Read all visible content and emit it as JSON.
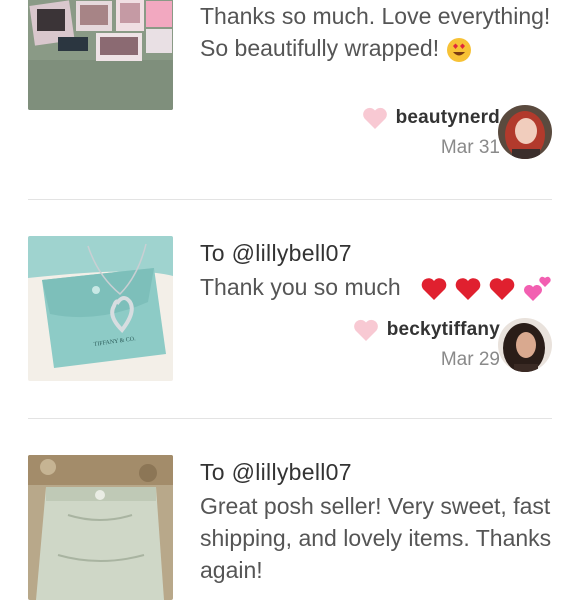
{
  "reviews": [
    {
      "to": "",
      "message": "Thanks so much. Love everything! So beautifully wrapped!",
      "emojis": [
        "heart-eyes-emoji"
      ],
      "username": "beautynerd",
      "date": "Mar 31",
      "image": "makeup-palettes-photo",
      "avatar": "red-hair-avatar"
    },
    {
      "to": "To @lillybell07",
      "message": "Thank you so much",
      "emojis": [
        "red-heart-emoji",
        "red-heart-emoji",
        "red-heart-emoji",
        "sparkling-heart-emoji"
      ],
      "username": "beckytiffany",
      "date": "Mar 29",
      "image": "tiffany-pouch-necklace-photo",
      "avatar": "dark-hair-avatar"
    },
    {
      "to": "To @lillybell07",
      "message": "Great posh seller! Very sweet, fast shipping, and lovely items. Thanks again!",
      "emojis": [],
      "image": "denim-skirt-photo"
    }
  ],
  "tiffany_pouch_text": "TIFFANY & CO.",
  "colors": {
    "like_heart": "#f8c9d3",
    "divider": "#e3e3e3",
    "date": "#8a8a8a"
  }
}
